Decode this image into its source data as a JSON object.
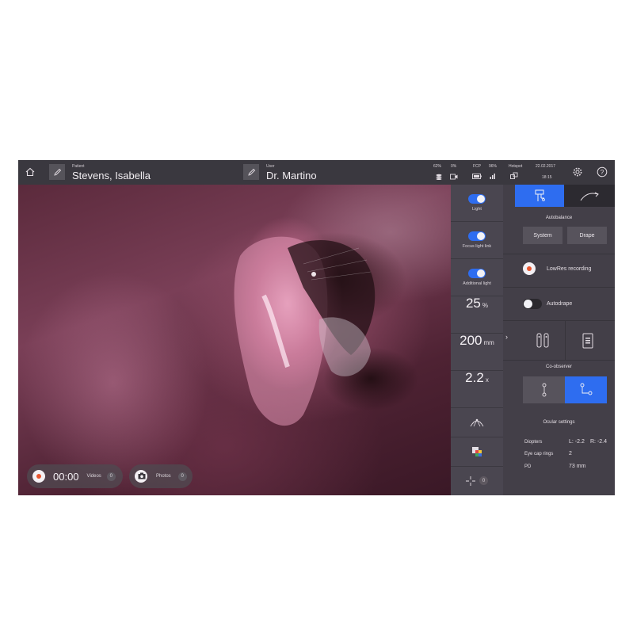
{
  "topbar": {
    "patient_label": "Patient",
    "patient_name": "Stevens, Isabella",
    "user_label": "User",
    "user_name": "Dr. Martino",
    "status_pct1": "62%",
    "status_pct2": "0%",
    "fcp_label": "FCP",
    "battery_pct": "96%",
    "hotspot_label": "Hotspot",
    "date": "22.02.2017",
    "time": "18:15"
  },
  "recording": {
    "timer": "00:00",
    "videos_label": "Videos",
    "videos_count": "0",
    "photos_label": "Photos",
    "photos_count": "0"
  },
  "midcol": {
    "light_label": "Light",
    "focus_light_link_label": "Focus light link",
    "additional_light_label": "Additional light",
    "brightness_value": "25",
    "brightness_unit": "%",
    "distance_value": "200",
    "distance_unit": "mm",
    "zoom_value": "2.2",
    "zoom_unit": "x",
    "marker_count": "0"
  },
  "rightpanel": {
    "autobalance_label": "Autobalance",
    "system_label": "System",
    "drape_label": "Drape",
    "lowres_label": "LowRes recording",
    "autodrape_label": "Autodrape",
    "coobserver_label": "Co-observer",
    "ocular_settings_label": "Ocular settings",
    "diopters_label": "Diopters",
    "diopters_left": "L: -2.2",
    "diopters_right": "R: -2.4",
    "eye_cap_label": "Eye cap rings",
    "eye_cap_value": "2",
    "pd_label": "PD",
    "pd_value": "73 mm"
  },
  "colors": {
    "accent": "#2e6df0",
    "record": "#e8552f"
  }
}
